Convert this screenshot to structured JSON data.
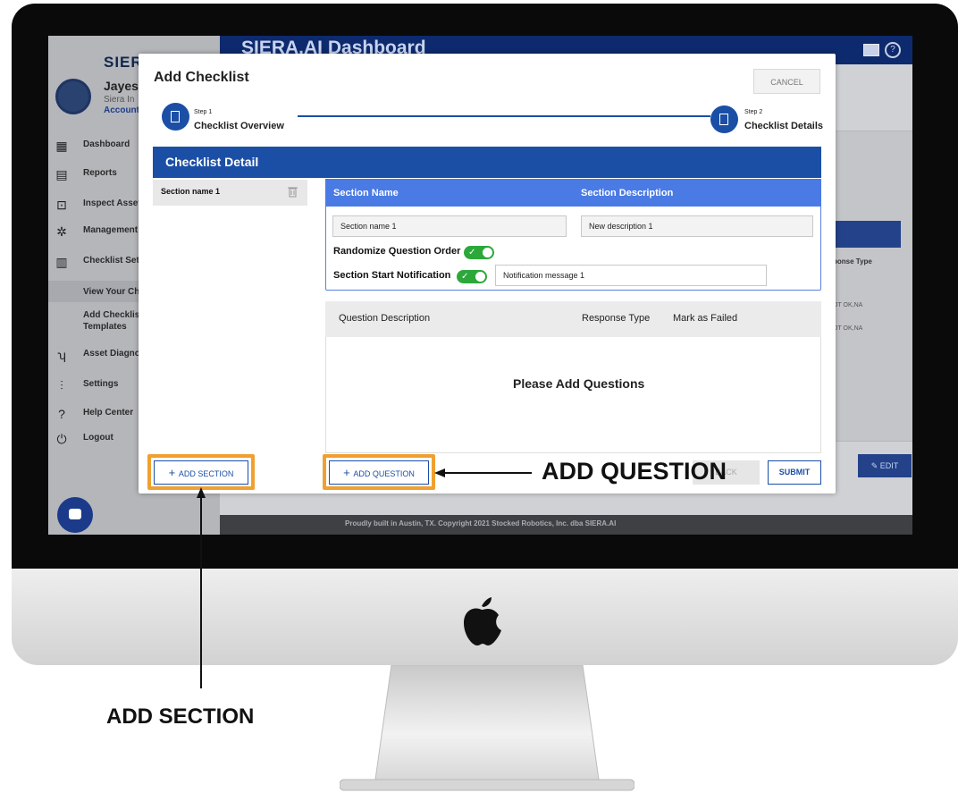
{
  "app": {
    "title": "SIERA.AI Dashboard",
    "logo": "SIERA",
    "user_name": "Jayesh",
    "company": "Siera In",
    "account": "Account",
    "footer": "Proudly built in Austin, TX. Copyright 2021 Stocked Robotics, Inc. dba SIERA.AI"
  },
  "sidebar": {
    "items": [
      {
        "label": "Dashboard",
        "icon": "grid-icon"
      },
      {
        "label": "Reports",
        "icon": "reports-icon"
      },
      {
        "label": "Inspect Asset",
        "icon": "inspect-icon"
      },
      {
        "label": "Management",
        "icon": "network-icon"
      },
      {
        "label": "Checklist Set",
        "icon": "checklist-icon"
      },
      {
        "label": "View Your Ch",
        "icon": ""
      },
      {
        "label": "Add Checklis",
        "icon": ""
      },
      {
        "label": "Templates",
        "icon": ""
      },
      {
        "label": "Asset Diagno",
        "icon": "stethoscope-icon"
      },
      {
        "label": "Settings",
        "icon": "sliders-icon"
      },
      {
        "label": "Help Center",
        "icon": "help-icon"
      },
      {
        "label": "Logout",
        "icon": "power-icon"
      }
    ]
  },
  "background": {
    "column_header": "ponse Type",
    "row_values": [
      "OT OK,NA",
      "OT OK,NA"
    ],
    "edit_label": "EDIT"
  },
  "modal": {
    "title": "Add Checklist",
    "cancel_label": "CANCEL",
    "step1": {
      "small": "Step 1",
      "label": "Checklist Overview"
    },
    "step2": {
      "small": "Step 2",
      "label": "Checklist Details"
    },
    "detail_title": "Checklist Detail",
    "sections": [
      {
        "label": "Section name 1"
      }
    ],
    "section_name_header": "Section Name",
    "section_desc_header": "Section Description",
    "section_name_value": "Section name 1",
    "section_desc_value": "New description 1",
    "randomize_label": "Randomize Question Order",
    "randomize_on": true,
    "notification_label": "Section Start Notification",
    "notification_on": true,
    "notification_value": "Notification message 1",
    "question_headers": {
      "description": "Question Description",
      "response": "Response Type",
      "failed": "Mark as Failed"
    },
    "empty_message": "Please Add Questions",
    "add_section_label": "ADD SECTION",
    "add_question_label": "ADD QUESTION",
    "back_label": "BACK",
    "submit_label": "SUBMIT"
  },
  "callouts": {
    "add_question": "ADD QUESTION",
    "add_section": "ADD SECTION"
  },
  "colors": {
    "primary_blue": "#1b4fa6",
    "section_blue": "#4a7ae4",
    "highlight_orange": "#f0a030",
    "toggle_green": "#2ca83a"
  }
}
